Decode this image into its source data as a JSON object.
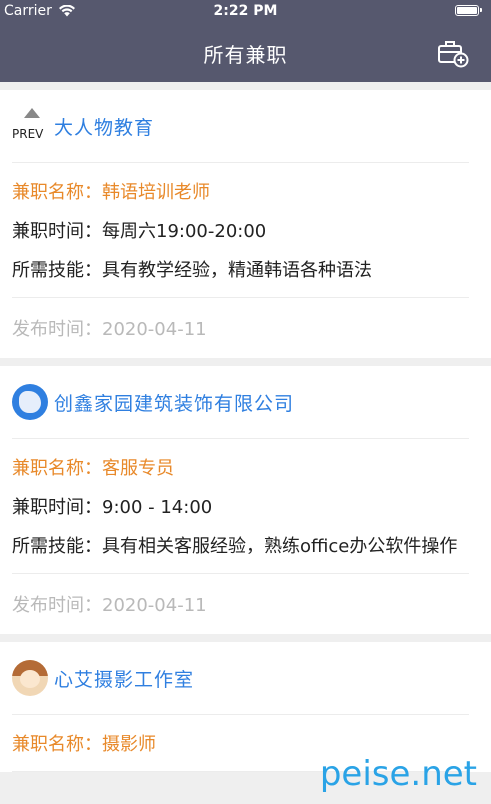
{
  "status_bar": {
    "carrier": "Carrier",
    "time": "2:22 PM"
  },
  "nav": {
    "title": "所有兼职",
    "add_icon": "briefcase-add-icon"
  },
  "jobs": [
    {
      "logo_text": "PREV",
      "company": "大人物教育",
      "job_name": "兼职名称：韩语培训老师",
      "job_time": "兼职时间：每周六19:00-20:00",
      "skills": "所需技能：具有教学经验，精通韩语各种语法",
      "publish": "发布时间：2020-04-11"
    },
    {
      "company": "创鑫家园建筑装饰有限公司",
      "job_name": "兼职名称：客服专员",
      "job_time": "兼职时间：9:00 - 14:00",
      "skills": "所需技能：具有相关客服经验，熟练office办公软件操作",
      "publish": "发布时间：2020-04-11"
    },
    {
      "company": "心艾摄影工作室",
      "job_name": "兼职名称：摄影师"
    }
  ],
  "watermark": "peise.net",
  "colors": {
    "nav_bg": "#56586e",
    "accent_blue": "#2f7fe0",
    "job_orange": "#e8892a",
    "muted": "#b9b9b9"
  }
}
